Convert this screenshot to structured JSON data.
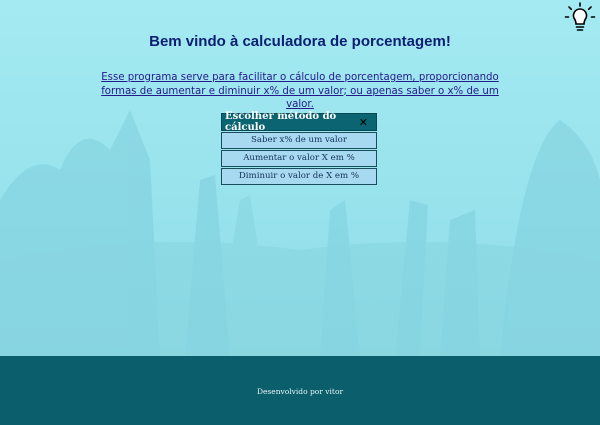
{
  "header": {
    "title": "Bem vindo à calculadora de porcentagem!",
    "description": "Esse programa serve para facilitar o cálculo de porcentagem, proporcionando formas de aumentar e diminuir x% de um valor; ou apenas saber o x% de um valor.",
    "theme_icon": "lightbulb-icon"
  },
  "menu": {
    "title": "Escolher método do cálculo",
    "close_glyph": "✕",
    "close_icon": "close-icon",
    "items": [
      {
        "label": "Saber x% de um valor"
      },
      {
        "label": "Aumentar o valor X em %"
      },
      {
        "label": "Diminuir o valor de X em %"
      }
    ]
  },
  "footer": {
    "text": "Desenvolvido por vitor"
  },
  "colors": {
    "background": "#9ee6ef",
    "footer": "#0b5e6c",
    "menu_header": "#0a6471",
    "menu_item": "#a7d9f0",
    "title": "#0c1f72"
  }
}
